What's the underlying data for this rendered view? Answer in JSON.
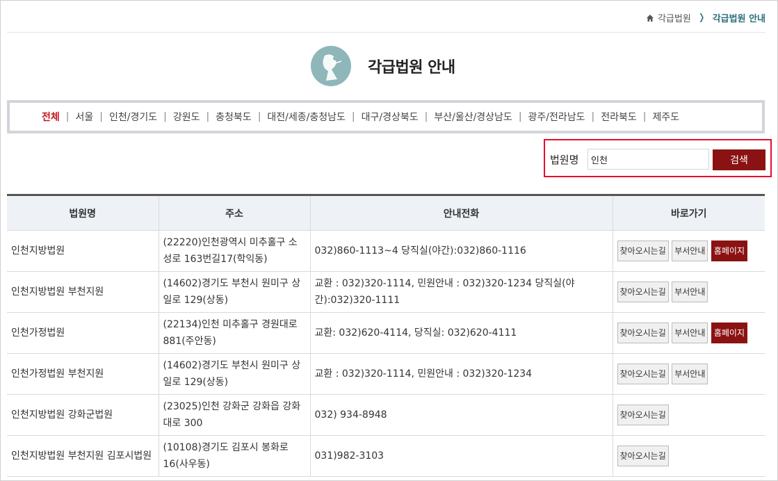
{
  "breadcrumb": {
    "home_label": "각급법원",
    "current": "각급법원 안내"
  },
  "page": {
    "title": "각급법원 안내"
  },
  "regions": [
    "전체",
    "서울",
    "인천/경기도",
    "강원도",
    "충청북도",
    "대전/세종/충청남도",
    "대구/경상북도",
    "부산/울산/경상남도",
    "광주/전라남도",
    "전라북도",
    "제주도"
  ],
  "search": {
    "label": "법원명",
    "value": "인천",
    "button": "검색"
  },
  "table": {
    "headers": [
      "법원명",
      "주소",
      "안내전화",
      "바로가기"
    ],
    "link_labels": {
      "directions": "찾아오시는길",
      "departments": "부서안내",
      "homepage": "홈페이지"
    },
    "rows": [
      {
        "name": "인천지방법원",
        "address": "(22220)인천광역시 미추홀구 소성로 163번길17(학익동)",
        "phone": "032)860-1113~4 당직실(야간):032)860-1116"
      },
      {
        "name": "인천지방법원 부천지원",
        "address": "(14602)경기도 부천시 원미구 상일로 129(상동)",
        "phone": "교환 : 032)320-1114, 민원안내 : 032)320-1234 당직실(야간):032)320-1111"
      },
      {
        "name": "인천가정법원",
        "address": "(22134)인천 미추홀구 경원대로 881(주안동)",
        "phone": "교환: 032)620-4114, 당직실: 032)620-4111"
      },
      {
        "name": "인천가정법원 부천지원",
        "address": "(14602)경기도 부천시 원미구 상일로 129(상동)",
        "phone": "교환 : 032)320-1114, 민원안내 : 032)320-1234"
      },
      {
        "name": "인천지방법원 강화군법원",
        "address": "(23025)인천 강화군 강화읍 강화대로 300",
        "phone": "032) 934-8948"
      },
      {
        "name": "인천지방법원 부천지원 김포시법원",
        "address": "(10108)경기도 김포시 봉화로 16(사우동)",
        "phone": "031)982-3103"
      }
    ]
  },
  "colors": {
    "accent": "#8b1212",
    "active_region": "#c6171e",
    "breadcrumb_current": "#2b6d7a",
    "highlight_border": "#e60c2d"
  }
}
